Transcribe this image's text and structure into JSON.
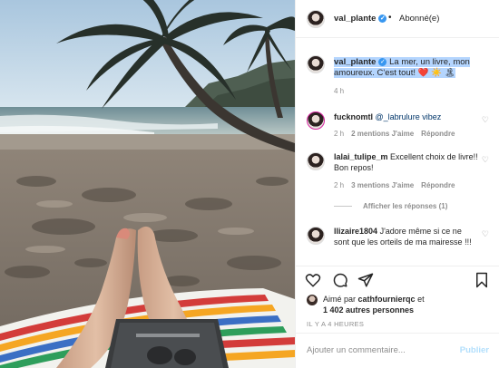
{
  "header": {
    "username": "val_plante",
    "separator": "•",
    "follow_status": "Abonné(e)"
  },
  "caption": {
    "username": "val_plante",
    "text": "La mer, un livre, mon amoureux. C'est tout!",
    "emojis": "❤️ ☀️ 🏝",
    "time": "4 h"
  },
  "comments": [
    {
      "username": "fucknomtl",
      "text": "@_labrulure vibez",
      "time": "2 h",
      "likes": "2 mentions J'aime",
      "reply": "Répondre"
    },
    {
      "username": "lalai_tulipe_m",
      "text": "Excellent choix de livre!! Bon repos!",
      "time": "2 h",
      "likes": "3 mentions J'aime",
      "reply": "Répondre",
      "view_replies": "Afficher les réponses (1)"
    },
    {
      "username": "llizaire1804",
      "text": "J'adore même si ce ne sont que les orteils de ma mairesse !!!"
    }
  ],
  "likes": {
    "prefix": "Aimé par",
    "user": "cathfournierqc",
    "suffix": "et",
    "others": "1 402 autres personnes"
  },
  "timestamp": "IL Y A 4 HEURES",
  "add_comment": {
    "placeholder": "Ajouter un commentaire...",
    "publish": "Publier"
  },
  "colors": {
    "verified": "#3897f0",
    "heart": "#ed4956",
    "secondary_text": "#8e8e8e",
    "publish_disabled": "#b2dffc",
    "selection": "#b4d5fe"
  },
  "icons": [
    "verified-icon",
    "heart-icon",
    "comment-icon",
    "share-icon",
    "bookmark-icon",
    "small-heart-icon"
  ]
}
